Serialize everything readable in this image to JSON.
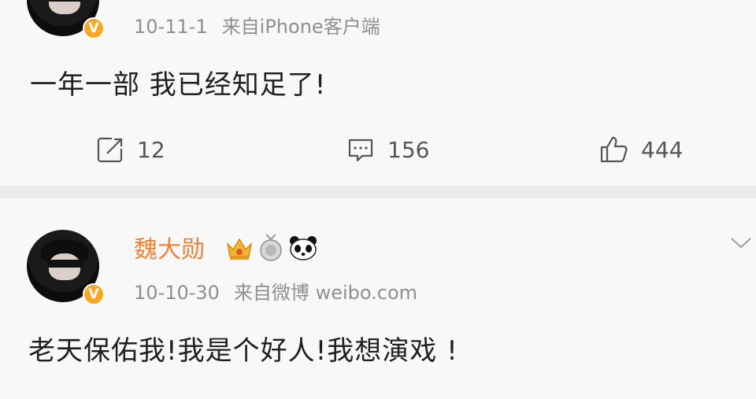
{
  "post1": {
    "date": "10-11-1",
    "source": "来自iPhone客户端",
    "text": "一年一部 我已经知足了!",
    "actions": {
      "repost_count": "12",
      "comment_count": "156",
      "like_count": "444"
    },
    "verified_badge": "V"
  },
  "post2": {
    "username": "魏大勋",
    "date": "10-10-30",
    "source": "来自微博 weibo.com",
    "text": "老天保佑我!我是个好人!我想演戏 !",
    "verified_badge": "V",
    "user_badges": [
      "crown-icon",
      "medal-icon",
      "panda-icon"
    ],
    "menu_icon": "chevron-down-icon"
  },
  "colors": {
    "background": "#f8f8f8",
    "username": "#e8823a",
    "meta_text": "#8f8f8f",
    "badge": "#f7a722"
  }
}
